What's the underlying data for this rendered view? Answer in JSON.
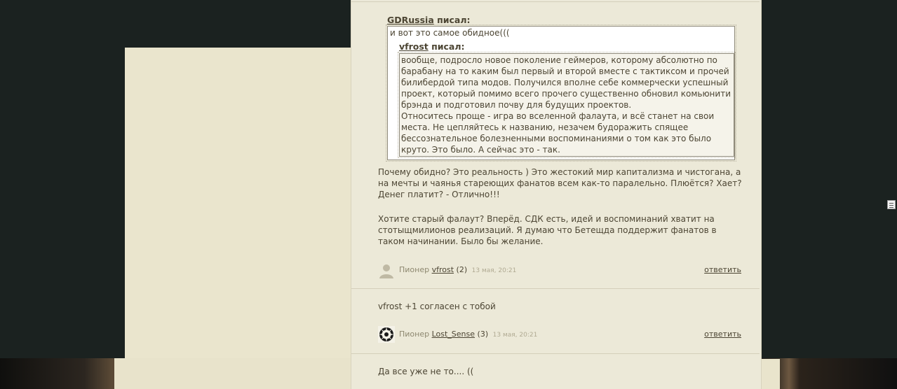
{
  "comment1": {
    "quote": {
      "author": "GDRussia",
      "said": "писал:",
      "text": "и вот это самое обидное(((",
      "nested": {
        "author": "vfrost",
        "said": "писал:",
        "p1": "вообще, подросло новое поколение геймеров, которому абсолютно по барабану на то каким был первый и второй вместе с тактиксом и прочей билибердой типа модов. Получился вполне себе коммерчески успешный проект, который помимо всего прочего существенно обновил комьюнити брэнда и подготовил почву для будущих проектов.",
        "p2": "Относитесь проще - игра во вселенной фалаута, и всё станет на свои места. Не цепляйтесь к названию, незачем будоражить спящее бессознательное болезненными воспоминаниями о том как это было круто. Это было. А сейчас это - так."
      }
    },
    "para1": "Почему обидно? Это реальность ) Это жестокий мир капитализма и чистогана, а на мечты и чаянья стареющих фанатов всем как-то паралельно. Плюётся? Хает? Денег платит? - Отлично!!!",
    "para2": "Хотите старый фалаут? Вперёд. СДК есть, идей и воспоминаний хватит на стотыщмилионов реализаций. Я думаю что Бетещда поддержит фанатов в таком начинании. Было бы желание.",
    "rank": "Пионер",
    "user": "vfrost",
    "count": "(2)",
    "date": "13 мая, 20:21",
    "reply": "ответить"
  },
  "comment2": {
    "text": "vfrost +1 согласен с тобой",
    "rank": "Пионер",
    "user": "Lost_Sense",
    "count": "(3)",
    "date": "13 мая, 20:21",
    "reply": "ответить"
  },
  "comment3": {
    "text": "Да все уже не то.... (("
  }
}
